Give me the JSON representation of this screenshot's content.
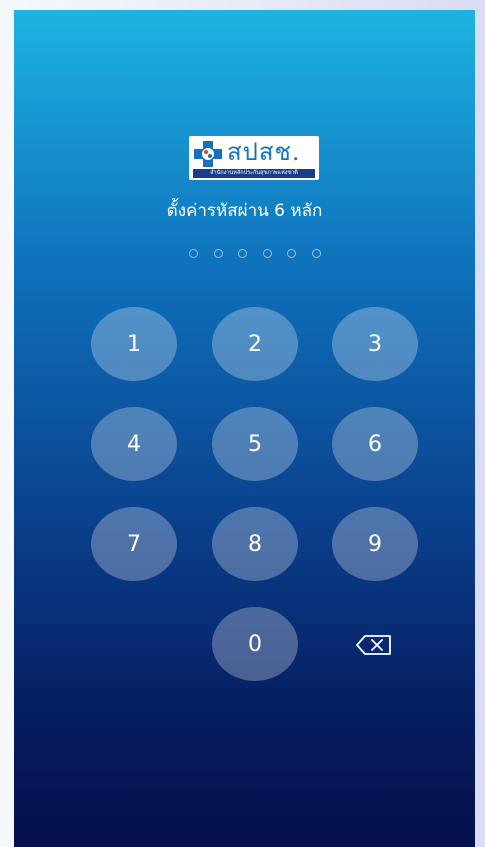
{
  "logo": {
    "main_text": "สปสช.",
    "sub_text": "สำนักงานหลักประกันสุขภาพแห่งชาติ",
    "icon": "health-cross-icon",
    "brand_color": "#1671bd"
  },
  "title": "ตั้งค่ารหัสผ่าน 6 หลัก",
  "pin": {
    "length": 6,
    "filled": 0
  },
  "keypad": {
    "keys": [
      "1",
      "2",
      "3",
      "4",
      "5",
      "6",
      "7",
      "8",
      "9",
      "0"
    ],
    "backspace_icon": "backspace-icon"
  },
  "colors": {
    "gradient_top": "#1eb4e2",
    "gradient_bottom": "#05104c",
    "key_fill": "rgba(255,255,255,0.28)"
  }
}
